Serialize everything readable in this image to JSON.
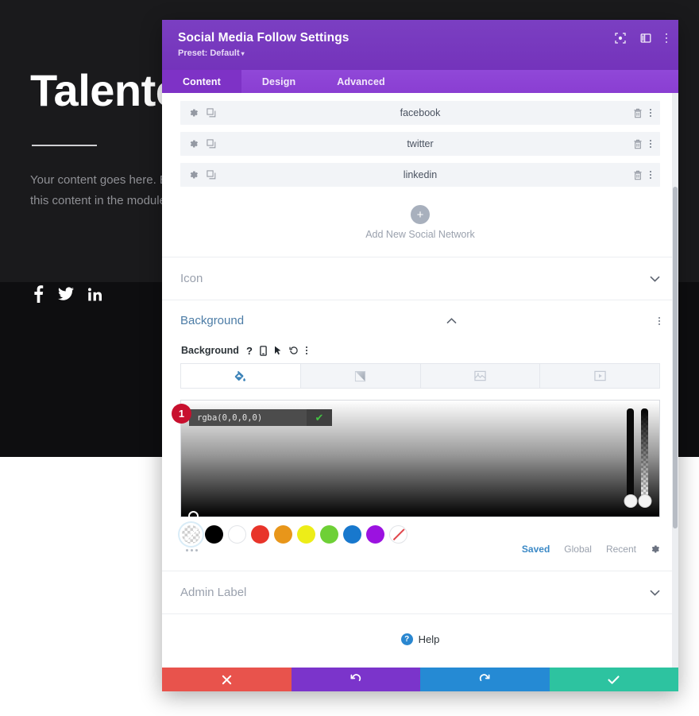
{
  "page": {
    "hero_title": "Talented",
    "hero_text": "Your content goes here. Edit or remove this text inline or in the module Content settings. You can also style every aspect of this content in the module Design settings and even apply custom CSS to this text in the module Advanced settings.",
    "social_icons": [
      "facebook-icon",
      "twitter-icon",
      "linkedin-icon"
    ]
  },
  "modal": {
    "title": "Social Media Follow Settings",
    "preset_label": "Preset: Default",
    "preset_caret": "▾",
    "header_icons": [
      "target-icon",
      "layout-panel-icon",
      "more-vertical-icon"
    ],
    "tabs": [
      {
        "label": "Content",
        "active": true
      },
      {
        "label": "Design",
        "active": false
      },
      {
        "label": "Advanced",
        "active": false
      }
    ],
    "social_networks": [
      {
        "name": "facebook",
        "settings_icon": "gear-icon",
        "duplicate_icon": "duplicate-icon",
        "delete_icon": "trash-icon",
        "menu_icon": "more-vertical-icon"
      },
      {
        "name": "twitter",
        "settings_icon": "gear-icon",
        "duplicate_icon": "duplicate-icon",
        "delete_icon": "trash-icon",
        "menu_icon": "more-vertical-icon"
      },
      {
        "name": "linkedin",
        "settings_icon": "gear-icon",
        "duplicate_icon": "duplicate-icon",
        "delete_icon": "trash-icon",
        "menu_icon": "more-vertical-icon"
      }
    ],
    "add_button": {
      "glyph": "+",
      "label": "Add New Social Network"
    },
    "sections": [
      {
        "id": "icon",
        "title": "Icon",
        "open": false,
        "chevron": "chevron-down-icon"
      },
      {
        "id": "background",
        "title": "Background",
        "open": true,
        "chevron": "chevron-up-icon"
      },
      {
        "id": "admin_label",
        "title": "Admin Label",
        "open": false,
        "chevron": "chevron-down-icon"
      }
    ],
    "background": {
      "field_label": "Background",
      "field_icons": [
        "help-icon",
        "responsive-icon",
        "hover-icon",
        "reset-icon",
        "more-vertical-icon"
      ],
      "type_tabs": [
        {
          "id": "color",
          "icon": "paint-bucket-icon",
          "active": true
        },
        {
          "id": "gradient",
          "icon": "gradient-icon",
          "active": false
        },
        {
          "id": "image",
          "icon": "image-icon",
          "active": false
        },
        {
          "id": "video",
          "icon": "video-icon",
          "active": false
        }
      ],
      "color_value": "rgba(0,0,0,0)",
      "color_placeholder": "rgba(0,0,0,0)",
      "confirm_glyph": "✔",
      "step_badge": "1",
      "swatches": [
        {
          "name": "transparent",
          "hex": "transparent",
          "selected": true
        },
        {
          "name": "black",
          "hex": "#000000",
          "selected": false
        },
        {
          "name": "white",
          "hex": "#ffffff",
          "selected": false
        },
        {
          "name": "red",
          "hex": "#e8342a",
          "selected": false
        },
        {
          "name": "orange",
          "hex": "#e8961a",
          "selected": false
        },
        {
          "name": "yellow",
          "hex": "#eded18",
          "selected": false
        },
        {
          "name": "green",
          "hex": "#6ed036",
          "selected": false
        },
        {
          "name": "blue",
          "hex": "#1878cd",
          "selected": false
        },
        {
          "name": "purple",
          "hex": "#9b12e0",
          "selected": false
        },
        {
          "name": "none",
          "hex": "none",
          "selected": false
        }
      ],
      "swatch_footer": [
        {
          "label": "Saved",
          "active": true
        },
        {
          "label": "Global",
          "active": false
        },
        {
          "label": "Recent",
          "active": false
        }
      ],
      "swatch_gear_icon": "gear-icon"
    },
    "help": {
      "badge": "?",
      "label": "Help",
      "icon": "help-icon"
    },
    "footer_buttons": [
      {
        "id": "cancel",
        "icon": "close-icon",
        "glyph": "✖",
        "color": "#e8534c"
      },
      {
        "id": "undo",
        "icon": "undo-icon",
        "glyph": "↺",
        "color": "#7b34cb"
      },
      {
        "id": "redo",
        "icon": "redo-icon",
        "glyph": "↻",
        "color": "#258ad4"
      },
      {
        "id": "save",
        "icon": "check-icon",
        "glyph": "✔",
        "color": "#2dc3a0"
      }
    ]
  }
}
